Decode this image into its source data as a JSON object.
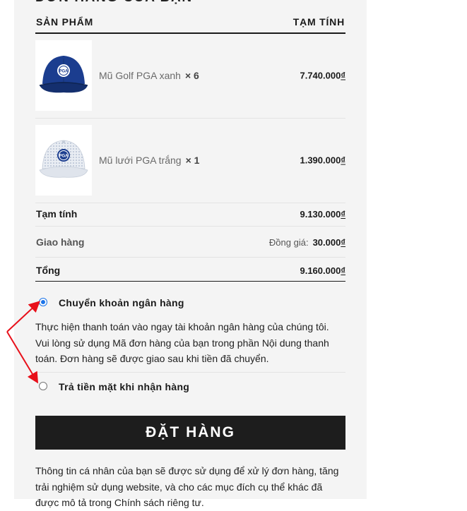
{
  "section_title": "ĐƠN HÀNG CỦA BẠN",
  "table": {
    "col_product": "SẢN PHẨM",
    "col_subtotal": "TẠM TÍNH"
  },
  "products": [
    {
      "name": "Mũ Golf PGA xanh",
      "qty": "× 6",
      "price": "7.740.000",
      "currency": "₫",
      "image": "navy-golf-cap-image"
    },
    {
      "name": "Mũ lưới PGA trắng",
      "qty": "× 1",
      "price": "1.390.000",
      "currency": "₫",
      "image": "white-mesh-cap-image"
    }
  ],
  "summary": {
    "subtotal_label": "Tạm tính",
    "subtotal_value": "9.130.000",
    "shipping_label": "Giao hàng",
    "shipping_method": "Đồng giá:",
    "shipping_value": "30.000",
    "total_label": "Tổng",
    "total_value": "9.160.000",
    "currency": "₫"
  },
  "payment": {
    "methods": [
      {
        "label": "Chuyển khoản ngân hàng",
        "selected": true
      },
      {
        "label": "Trả tiền mặt khi nhận hàng",
        "selected": false
      }
    ],
    "bank_description": "Thực hiện thanh toán vào ngay tài khoản ngân hàng của chúng tôi. Vui lòng sử dụng Mã đơn hàng của bạn trong phần Nội dung thanh toán. Đơn hàng sẽ được giao sau khi tiền đã chuyển."
  },
  "order_button": "ĐẶT HÀNG",
  "privacy_text": "Thông tin cá nhân của bạn sẽ được sử dụng để xử lý đơn hàng, tăng trải nghiệm sử dụng website, và cho các mục đích cụ thể khác đã được mô tả trong Chính sách riêng tư.",
  "annotation_color": "#e8101a",
  "accent_color": "#1a73e8"
}
